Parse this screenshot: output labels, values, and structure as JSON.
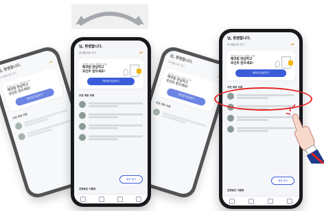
{
  "title": "님, 환영합니다.",
  "top_icon": "rotate-arrow-icon",
  "card": {
    "line1": "환경을 지키는 현명한 선택",
    "line2": "에코컵 반납하고",
    "line3": "포인트 받으세요!",
    "button": "에코컵 반납하기"
  },
  "sub_store": "내 매장으로 가기",
  "sub_badge": "0P",
  "list_title": "주변 매장 리뷰",
  "fab_label": "매장 찾기",
  "bottom_label": "진행중인 이벤트",
  "accent": "#3b5cd9",
  "highlight_color": "#e52222"
}
